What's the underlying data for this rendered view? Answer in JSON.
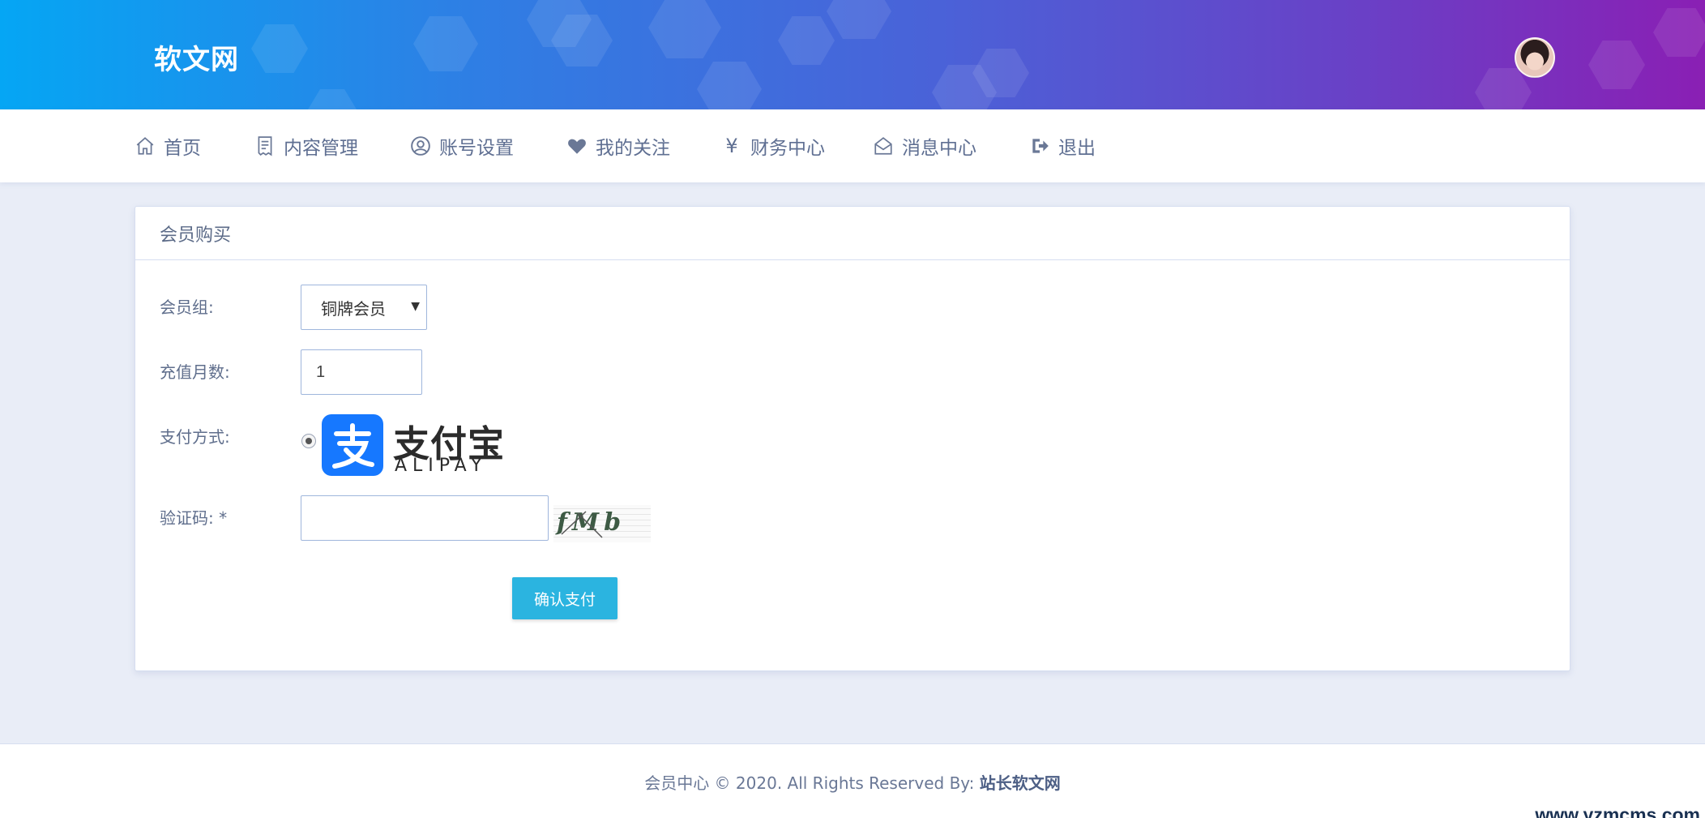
{
  "header": {
    "site_name": "软文网"
  },
  "nav": {
    "items": [
      {
        "label": "首页",
        "icon": "home-icon"
      },
      {
        "label": "内容管理",
        "icon": "receipt-icon"
      },
      {
        "label": "账号设置",
        "icon": "user-circle-icon"
      },
      {
        "label": "我的关注",
        "icon": "heart-icon"
      },
      {
        "label": "财务中心",
        "icon": "yen-icon"
      },
      {
        "label": "消息中心",
        "icon": "envelope-open-icon"
      },
      {
        "label": "退出",
        "icon": "sign-out-icon"
      }
    ],
    "yen_glyph": "¥"
  },
  "card": {
    "title": "会员购买",
    "member_group_label": "会员组:",
    "member_group_value": "铜牌会员",
    "months_label": "充值月数:",
    "months_value": "1",
    "payment_label": "支付方式:",
    "payment_method_cn": "支付宝",
    "payment_method_en": "ALIPAY",
    "captcha_label": "验证码: *",
    "captcha_value": "",
    "captcha_text": "fMb",
    "submit_label": "确认支付"
  },
  "footer": {
    "text_prefix": "会员中心 © 2020. All Rights Reserved By: ",
    "text_link": "站长软文网",
    "watermark": "www.yzmcms.com"
  },
  "colors": {
    "header_gradient_start": "#05a6f4",
    "header_gradient_end": "#8a1fb4",
    "button": "#2bb4e0",
    "alipay_blue": "#1678ff",
    "page_bg": "#e9edf7"
  }
}
